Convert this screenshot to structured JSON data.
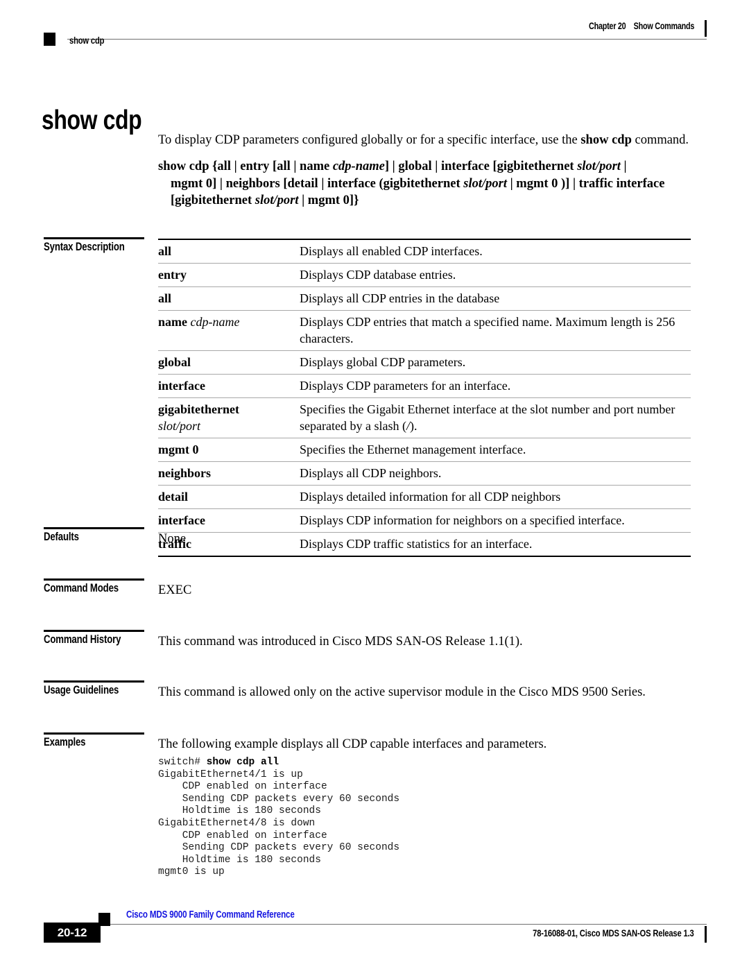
{
  "header": {
    "chapter": "Chapter 20",
    "chapter_title": "Show Commands",
    "running_command": "show cdp"
  },
  "title": "show cdp",
  "intro": {
    "before": "To display CDP parameters configured globally or for a specific interface, use the ",
    "bold": "show cdp",
    "after": " command."
  },
  "syntax": {
    "line1_a": "show cdp {all | entry [all | name ",
    "line1_italic": "cdp-name",
    "line1_b": "] | global | interface [gigbitethernet ",
    "line1_italic2": "slot/port",
    "line1_c": " |",
    "line2_a": "mgmt 0] | neighbors [detail | interface (gigbitethernet ",
    "line2_italic": "slot/port",
    "line2_b": " | mgmt 0 )] | traffic interface",
    "line3_a": "[gigbitethernet ",
    "line3_italic": "slot/port",
    "line3_b": " | mgmt 0]}"
  },
  "sections": {
    "syntax_description": "Syntax Description",
    "defaults": "Defaults",
    "command_modes": "Command Modes",
    "command_history": "Command History",
    "usage_guidelines": "Usage Guidelines",
    "examples": "Examples"
  },
  "syntax_table": [
    {
      "term": "all",
      "term_italic": "",
      "term_sub": "",
      "desc": "Displays all enabled CDP interfaces."
    },
    {
      "term": "entry",
      "term_italic": "",
      "term_sub": "",
      "desc": "Displays CDP database entries."
    },
    {
      "term": "all",
      "term_italic": "",
      "term_sub": "",
      "desc": "Displays all CDP entries in the database"
    },
    {
      "term": "name",
      "term_italic": "cdp-name",
      "term_sub": "",
      "desc": "Displays CDP entries that match a specified name. Maximum length is 256 characters."
    },
    {
      "term": "global",
      "term_italic": "",
      "term_sub": "",
      "desc": "Displays global CDP parameters."
    },
    {
      "term": "interface",
      "term_italic": "",
      "term_sub": "",
      "desc": "Displays CDP parameters for an interface."
    },
    {
      "term": "gigabitethernet",
      "term_italic": "",
      "term_sub": "slot/port",
      "desc_a": "Specifies the Gigabit Ethernet interface at the slot number and port number separated by a slash (",
      "desc_italic": "/",
      "desc_b": ")."
    },
    {
      "term": "mgmt 0",
      "term_italic": "",
      "term_sub": "",
      "desc": "Specifies the Ethernet management interface."
    },
    {
      "term": "neighbors",
      "term_italic": "",
      "term_sub": "",
      "desc": "Displays all CDP neighbors."
    },
    {
      "term": "detail",
      "term_italic": "",
      "term_sub": "",
      "desc": "Displays detailed information for all CDP neighbors"
    },
    {
      "term": "interface",
      "term_italic": "",
      "term_sub": "",
      "desc": "Displays CDP information for neighbors on a specified interface."
    },
    {
      "term": "traffic",
      "term_italic": "",
      "term_sub": "",
      "desc": "Displays CDP traffic statistics for an interface."
    }
  ],
  "content": {
    "defaults": "None",
    "command_modes": "EXEC",
    "command_history": "This command was introduced in Cisco MDS SAN-OS Release 1.1(1).",
    "usage_guidelines": "This command is allowed only on the active supervisor module in the Cisco MDS 9500 Series.",
    "examples_intro": "The following example displays all CDP capable interfaces and parameters."
  },
  "example_code": {
    "prompt": "switch# ",
    "command": "show cdp all",
    "output": "GigabitEthernet4/1 is up\n    CDP enabled on interface\n    Sending CDP packets every 60 seconds\n    Holdtime is 180 seconds\nGigabitEthernet4/8 is down\n    CDP enabled on interface\n    Sending CDP packets every 60 seconds\n    Holdtime is 180 seconds\nmgmt0 is up"
  },
  "footer": {
    "page_number": "20-12",
    "book_title": "Cisco MDS 9000 Family Command Reference",
    "doc_id": "78-16088-01, Cisco MDS SAN-OS Release 1.3"
  },
  "colors": {
    "link_blue": "#1414e0",
    "rule_gray": "#6f6f6f",
    "table_rule": "#a8a8a8"
  }
}
